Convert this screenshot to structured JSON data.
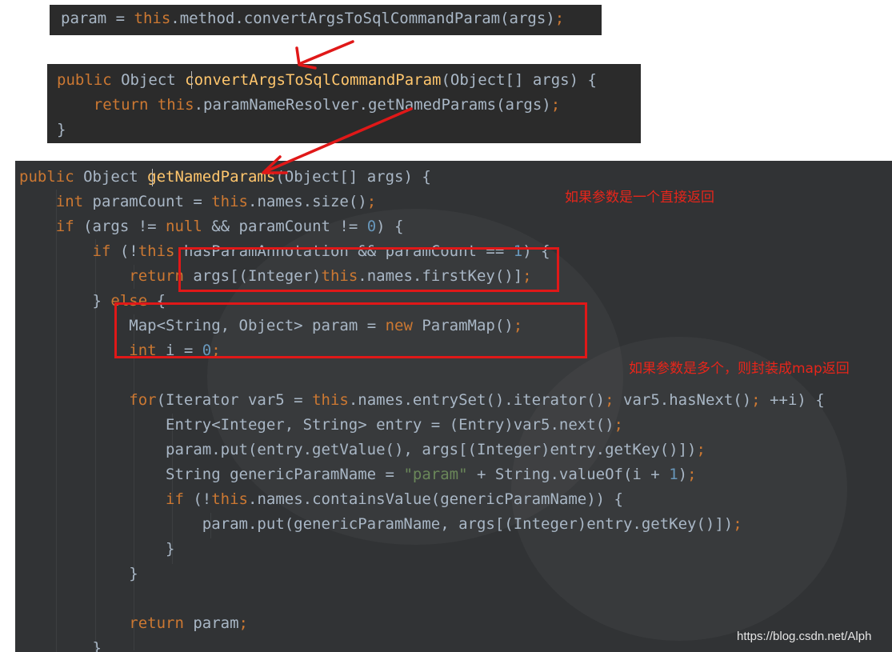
{
  "snippet1": {
    "lines": [
      [
        [
          "param = ",
          ""
        ],
        [
          "this",
          "kw"
        ],
        [
          ".method.convertArgsToSqlCommandParam(args)",
          ""
        ],
        [
          ";",
          "kw"
        ]
      ]
    ]
  },
  "snippet2": {
    "lines": [
      [
        [
          "public ",
          "kw"
        ],
        [
          "Object ",
          ""
        ],
        [
          "convertArgsToSqlCommandParam",
          "fn"
        ],
        [
          "(Object[] args) {",
          ""
        ]
      ],
      [
        [
          "    return ",
          "kw"
        ],
        [
          "this",
          "kw"
        ],
        [
          ".paramNameResolver.getNamedParams(args)",
          ""
        ],
        [
          ";",
          "kw"
        ]
      ],
      [
        [
          "}",
          ""
        ]
      ]
    ]
  },
  "snippet3": {
    "lines": [
      [
        [
          "public ",
          "kw"
        ],
        [
          "Object ",
          ""
        ],
        [
          "getNamedParams",
          "fn"
        ],
        [
          "(Object[] args) {",
          ""
        ]
      ],
      [
        [
          "    int ",
          "kw"
        ],
        [
          "paramCount = ",
          ""
        ],
        [
          "this",
          "kw"
        ],
        [
          ".names.size()",
          ""
        ],
        [
          ";",
          "kw"
        ]
      ],
      [
        [
          "    if ",
          "kw"
        ],
        [
          "(args != ",
          ""
        ],
        [
          "null ",
          "kw"
        ],
        [
          "&& paramCount != ",
          ""
        ],
        [
          "0",
          "num"
        ],
        [
          ") {",
          ""
        ]
      ],
      [
        [
          "        if ",
          "kw"
        ],
        [
          "(!",
          ""
        ],
        [
          "this",
          "kw"
        ],
        [
          ".hasParamAnnotation && paramCount == ",
          ""
        ],
        [
          "1",
          "num"
        ],
        [
          ") {",
          ""
        ]
      ],
      [
        [
          "            return ",
          "kw"
        ],
        [
          "args[(Integer)",
          ""
        ],
        [
          "this",
          "kw"
        ],
        [
          ".names.firstKey()]",
          ""
        ],
        [
          ";",
          "kw"
        ]
      ],
      [
        [
          "        } ",
          ""
        ],
        [
          "else ",
          "kw"
        ],
        [
          "{",
          ""
        ]
      ],
      [
        [
          "            ",
          ""
        ],
        [
          "Map<String, Object> param = ",
          ""
        ],
        [
          "new ",
          "kw"
        ],
        [
          "ParamMap()",
          ""
        ],
        [
          ";",
          "kw"
        ]
      ],
      [
        [
          "            int ",
          "kw"
        ],
        [
          "i = ",
          ""
        ],
        [
          "0",
          "num"
        ],
        [
          ";",
          "kw"
        ]
      ],
      [
        [
          "",
          ""
        ]
      ],
      [
        [
          "            for",
          "kw"
        ],
        [
          "(Iterator var5 = ",
          ""
        ],
        [
          "this",
          "kw"
        ],
        [
          ".names.entrySet().iterator()",
          ""
        ],
        [
          "; ",
          "kw"
        ],
        [
          "var5.hasNext()",
          ""
        ],
        [
          "; ",
          "kw"
        ],
        [
          "++i) {",
          ""
        ]
      ],
      [
        [
          "                Entry<Integer, String> entry = (Entry)var5.next()",
          ""
        ],
        [
          ";",
          "kw"
        ]
      ],
      [
        [
          "                param.put(entry.getValue(), args[(Integer)entry.getKey()])",
          ""
        ],
        [
          ";",
          "kw"
        ]
      ],
      [
        [
          "                String genericParamName = ",
          ""
        ],
        [
          "\"param\"",
          "str"
        ],
        [
          " + String.valueOf(i + ",
          ""
        ],
        [
          "1",
          "num"
        ],
        [
          ")",
          ""
        ],
        [
          ";",
          "kw"
        ]
      ],
      [
        [
          "                if ",
          "kw"
        ],
        [
          "(!",
          ""
        ],
        [
          "this",
          "kw"
        ],
        [
          ".names.containsValue(genericParamName)) {",
          ""
        ]
      ],
      [
        [
          "                    param.put(genericParamName, args[(Integer)entry.getKey()])",
          ""
        ],
        [
          ";",
          "kw"
        ]
      ],
      [
        [
          "                }",
          ""
        ]
      ],
      [
        [
          "            }",
          ""
        ]
      ],
      [
        [
          "",
          ""
        ]
      ],
      [
        [
          "            return ",
          "kw"
        ],
        [
          "param",
          ""
        ],
        [
          ";",
          "kw"
        ]
      ],
      [
        [
          "        }",
          ""
        ]
      ]
    ]
  },
  "annotations": {
    "note_single": "如果参数是一个直接返回",
    "note_multi": "如果参数是多个，则封装成map返回"
  },
  "watermark": "https://blog.csdn.net/Alph",
  "colors": {
    "background": "#2b2b2b",
    "keyword": "#cc7832",
    "default": "#a9b7c6",
    "string": "#6a8759",
    "number": "#6897bb",
    "method_declaration": "#ffc66d",
    "annotation_red": "#e01818"
  }
}
